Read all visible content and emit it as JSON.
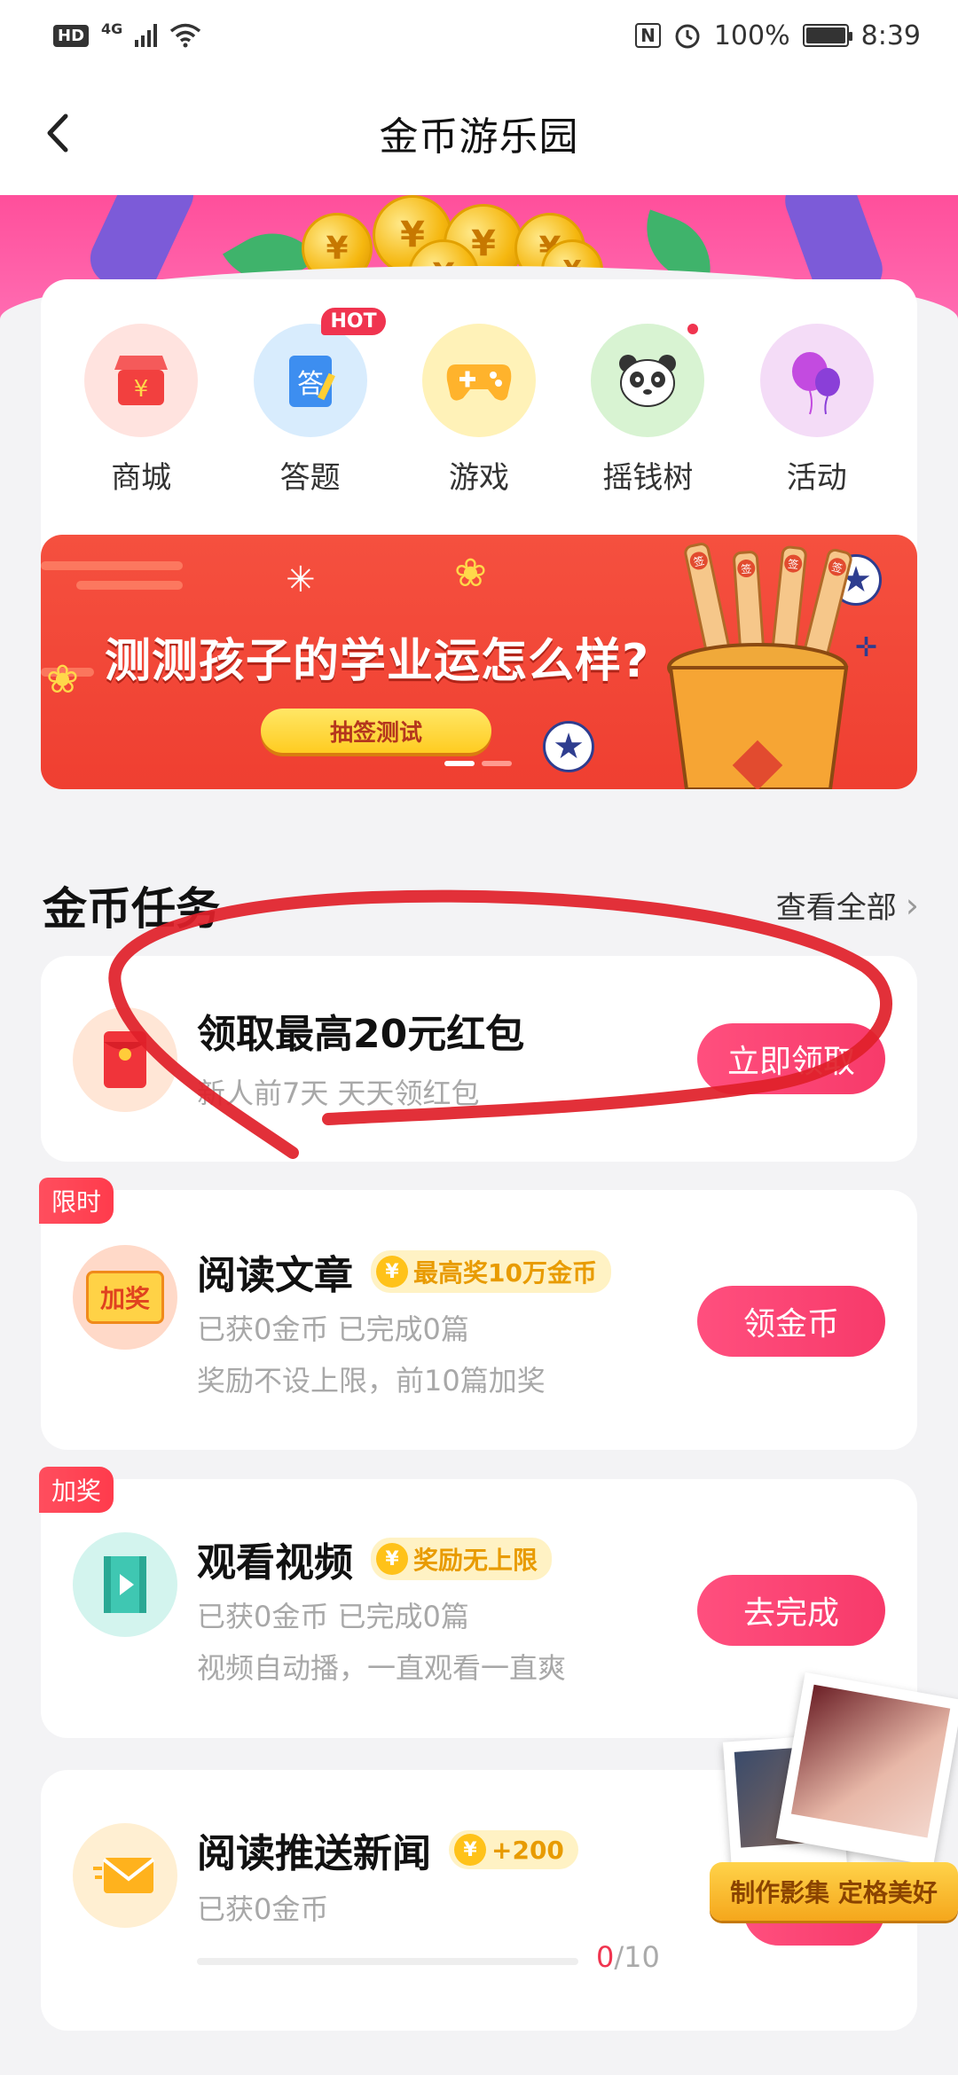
{
  "status_bar": {
    "hd": "HD",
    "network": "4G",
    "battery": "100%",
    "time": "8:39",
    "nfc": "N"
  },
  "nav": {
    "title": "金币游乐园"
  },
  "quick_icons": [
    {
      "label": "商城",
      "icon": "shop-icon"
    },
    {
      "label": "答题",
      "icon": "quiz-icon",
      "badge": "HOT"
    },
    {
      "label": "游戏",
      "icon": "gamepad-icon"
    },
    {
      "label": "摇钱树",
      "icon": "panda-icon",
      "dot": true
    },
    {
      "label": "活动",
      "icon": "balloon-icon"
    }
  ],
  "promo": {
    "title": "测测孩子的学业运怎么样?",
    "button": "抽签测试",
    "sticks": [
      "签",
      "签",
      "签",
      "签"
    ]
  },
  "tasks_section": {
    "title": "金币任务",
    "see_all": "查看全部"
  },
  "tasks": [
    {
      "title": "领取最高20元红包",
      "sub1": "新人前7天 天天领红包",
      "button": "立即领取"
    },
    {
      "corner": "限时",
      "icon_text": "加奖",
      "title": "阅读文章",
      "reward": "最高奖10万金币",
      "sub1": "已获0金币  已完成0篇",
      "sub2": "奖励不设上限，前10篇加奖",
      "button": "领金币"
    },
    {
      "corner": "加奖",
      "title": "观看视频",
      "reward": "奖励无上限",
      "sub1": "已获0金币  已完成0篇",
      "sub2": "视频自动播，一直观看一直爽",
      "button": "去完成"
    },
    {
      "title": "阅读推送新闻",
      "reward": "+200",
      "sub1": "已获0金币",
      "progress_current": "0",
      "progress_total": "/10"
    }
  ],
  "float_ad": {
    "label": "制作影集 定格美好"
  },
  "colors": {
    "primary": "#f73a6a",
    "gold": "#ffc219",
    "hero": "#ff4f9b",
    "annotation": "#e0202a"
  }
}
